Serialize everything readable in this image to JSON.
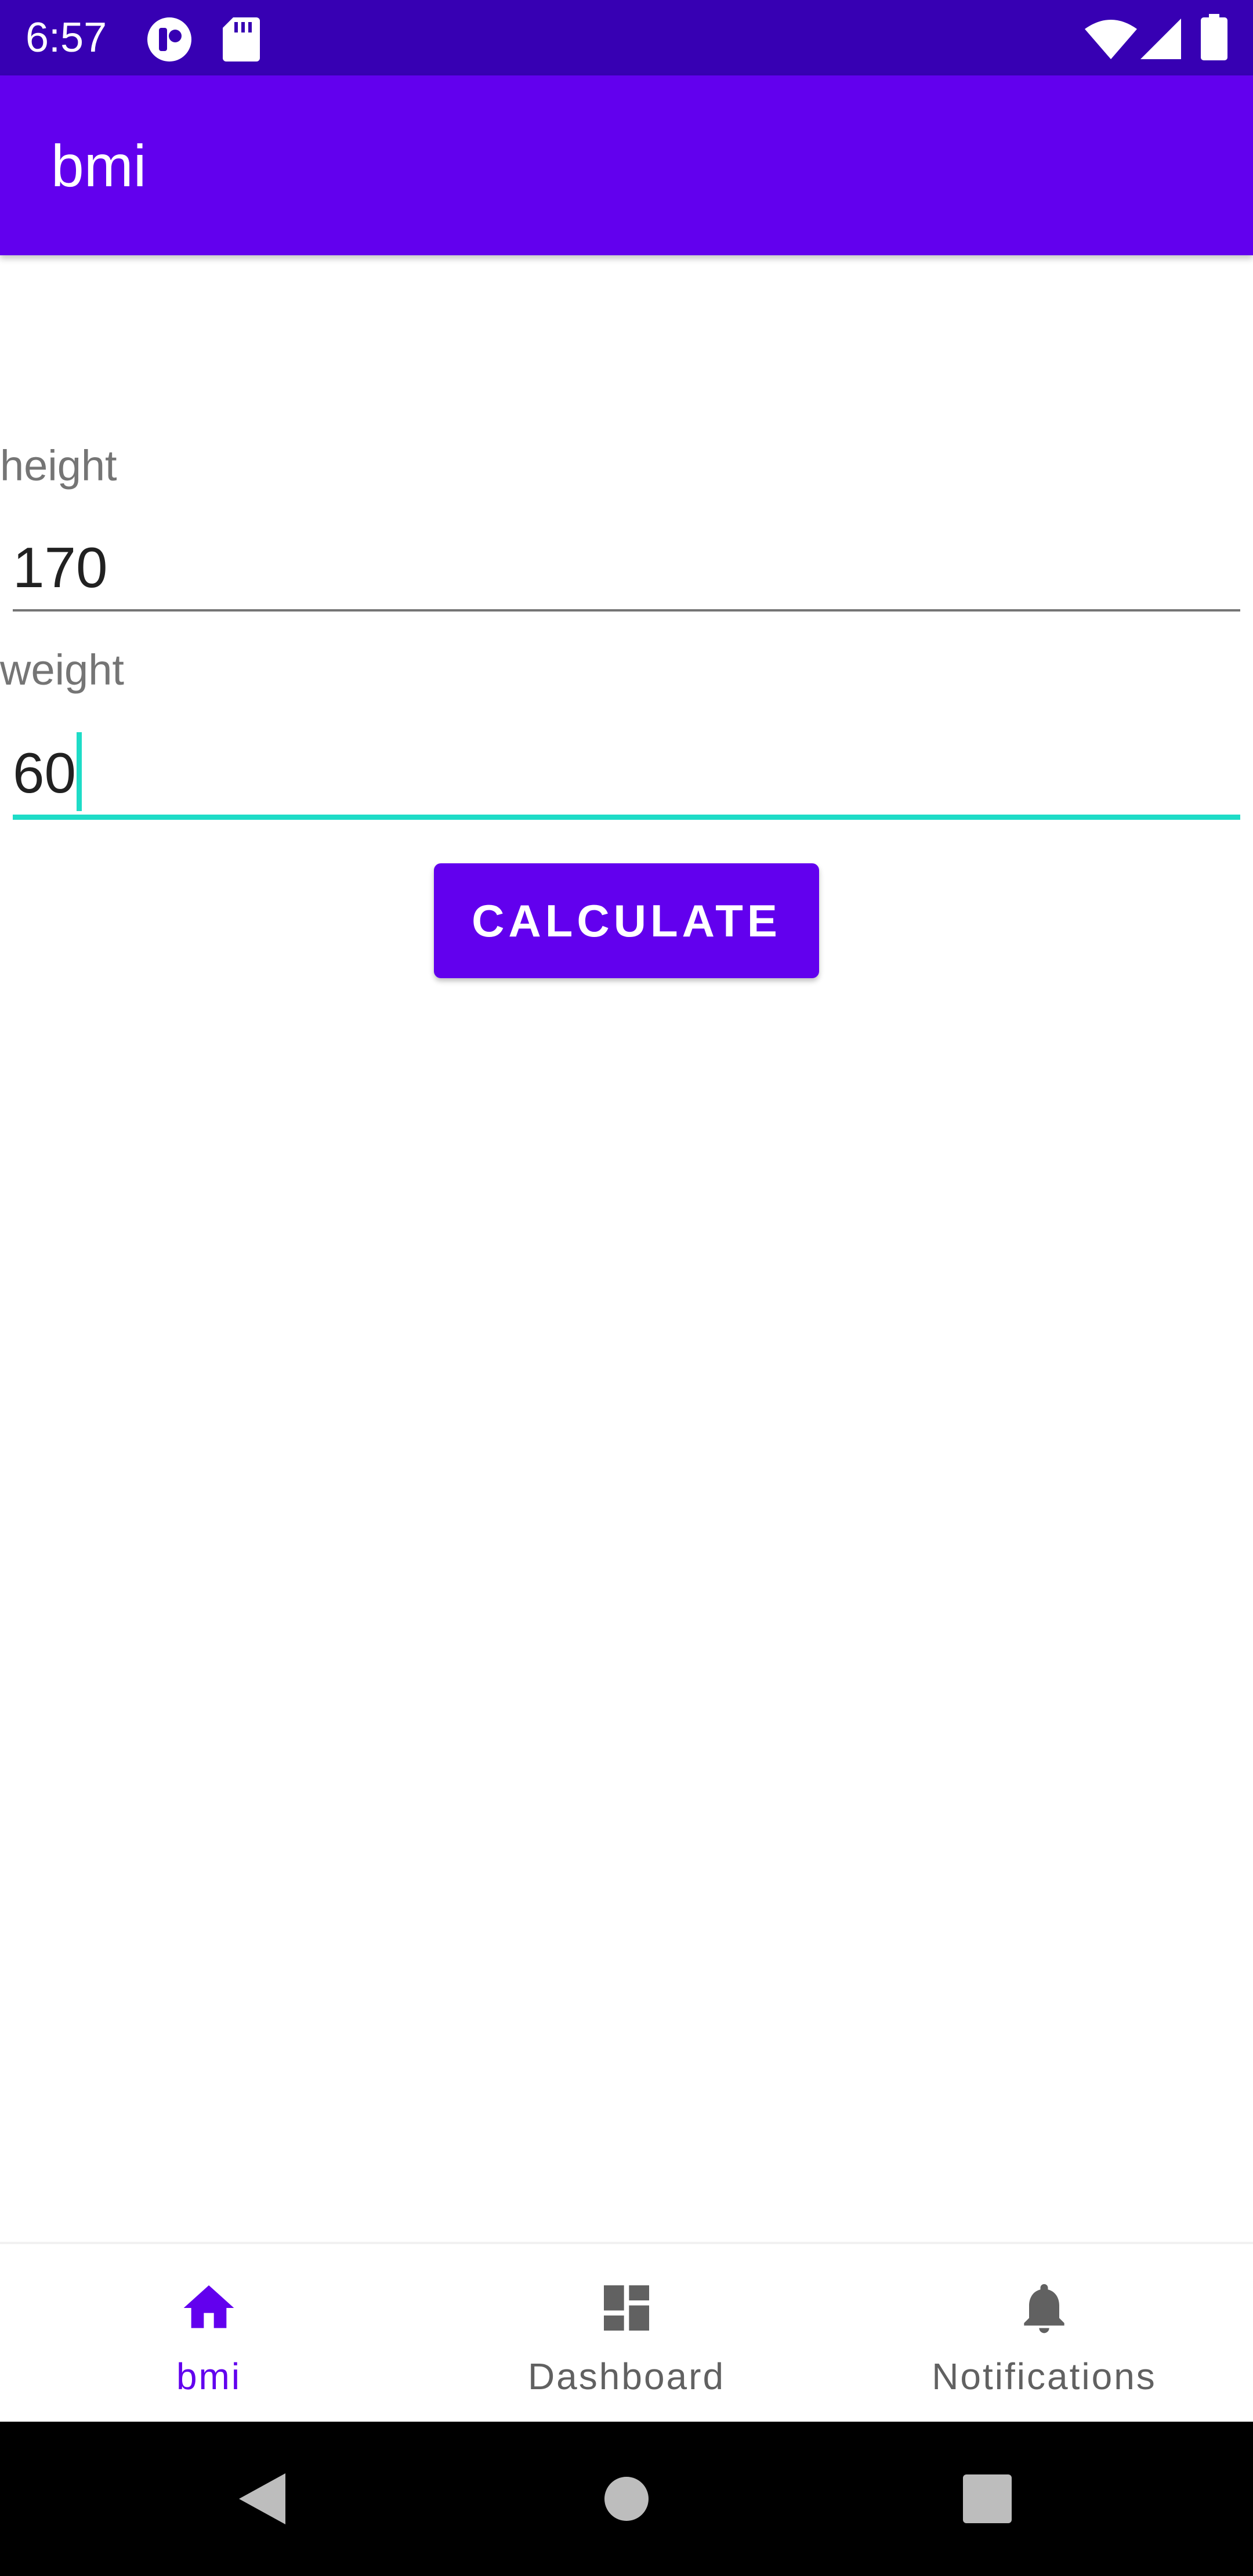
{
  "status_bar": {
    "time": "6:57",
    "left_icons": [
      "media-app-icon",
      "sd-card-icon"
    ],
    "right_icons": [
      "wifi-icon",
      "cell-signal-icon",
      "battery-icon"
    ],
    "background": "#3700B3"
  },
  "app_bar": {
    "title": "bmi",
    "background": "#6200EE"
  },
  "form": {
    "height_label": "height",
    "height_value": "170",
    "weight_label": "weight",
    "weight_value": "60",
    "focus_color": "#1EDCC7",
    "calculate_label": "CALCULATE"
  },
  "bottom_nav": {
    "items": [
      {
        "label": "bmi",
        "icon": "home-icon",
        "active": true
      },
      {
        "label": "Dashboard",
        "icon": "dashboard-icon",
        "active": false
      },
      {
        "label": "Notifications",
        "icon": "bell-icon",
        "active": false
      }
    ],
    "active_color": "#6200EE",
    "inactive_color": "#616161"
  },
  "system_nav": {
    "buttons": [
      "back-icon",
      "home-circle-icon",
      "recents-icon"
    ]
  }
}
